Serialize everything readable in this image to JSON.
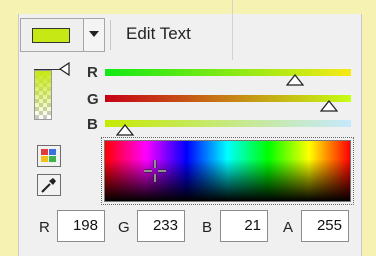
{
  "header": {
    "current_color": "#c6e915",
    "edit_text_label": "Edit Text"
  },
  "channels": {
    "r_label": "R",
    "g_label": "G",
    "b_label": "B"
  },
  "values": {
    "r_label": "R",
    "g_label": "G",
    "b_label": "B",
    "a_label": "A",
    "r": "198",
    "g": "233",
    "b": "21",
    "a": "255"
  },
  "colors": {
    "panel_bg": "#f0f0f0",
    "outer_bg": "#f6f3b2"
  },
  "icons": [
    "dropdown-arrow-icon",
    "palette-icon",
    "eyedropper-icon",
    "crosshair-icon"
  ]
}
